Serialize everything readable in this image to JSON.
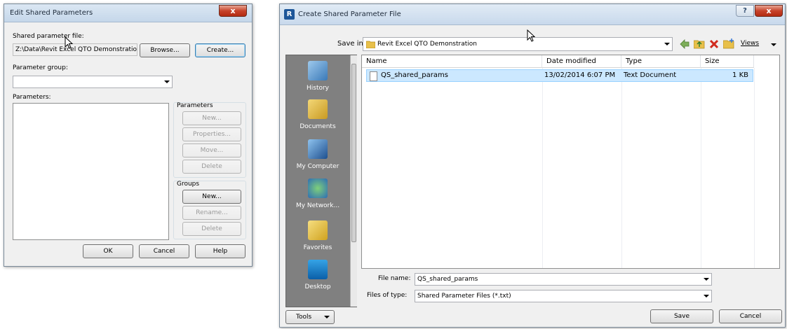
{
  "dialog1": {
    "title": "Edit Shared Parameters",
    "close_glyph": "x",
    "shared_file_label": "Shared parameter file:",
    "shared_file_path": "Z:\\Data\\Revit Excel QTO Demonstration\\",
    "browse_label": "Browse...",
    "create_label": "Create...",
    "param_group_label": "Parameter group:",
    "parameters_label": "Parameters:",
    "parameters_group": {
      "title": "Parameters",
      "new_label": "New...",
      "properties_label": "Properties...",
      "move_label": "Move...",
      "delete_label": "Delete"
    },
    "groups_group": {
      "title": "Groups",
      "new_label": "New...",
      "rename_label": "Rename...",
      "delete_label": "Delete"
    },
    "ok_label": "OK",
    "cancel_label": "Cancel",
    "help_label": "Help"
  },
  "dialog2": {
    "title": "Create Shared Parameter File",
    "help_glyph": "?",
    "close_glyph": "x",
    "save_in_label": "Save in:",
    "save_in_value": "Revit Excel QTO Demonstration",
    "views_label": "Views",
    "places": [
      "History",
      "Documents",
      "My Computer",
      "My Network...",
      "Favorites",
      "Desktop"
    ],
    "columns": {
      "name": "Name",
      "date": "Date modified",
      "type": "Type",
      "size": "Size"
    },
    "files": [
      {
        "name": "QS_shared_params",
        "date": "13/02/2014 6:07 PM",
        "type": "Text Document",
        "size": "1 KB"
      }
    ],
    "file_name_label": "File name:",
    "file_name_value": "QS_shared_params",
    "files_of_type_label": "Files of type:",
    "files_of_type_value": "Shared Parameter Files (*.txt)",
    "tools_label": "Tools",
    "save_label": "Save",
    "cancel_label": "Cancel"
  },
  "colors": {
    "places_bar": "#808080",
    "selection": "#cce8ff",
    "close_button": "#c7432b"
  }
}
